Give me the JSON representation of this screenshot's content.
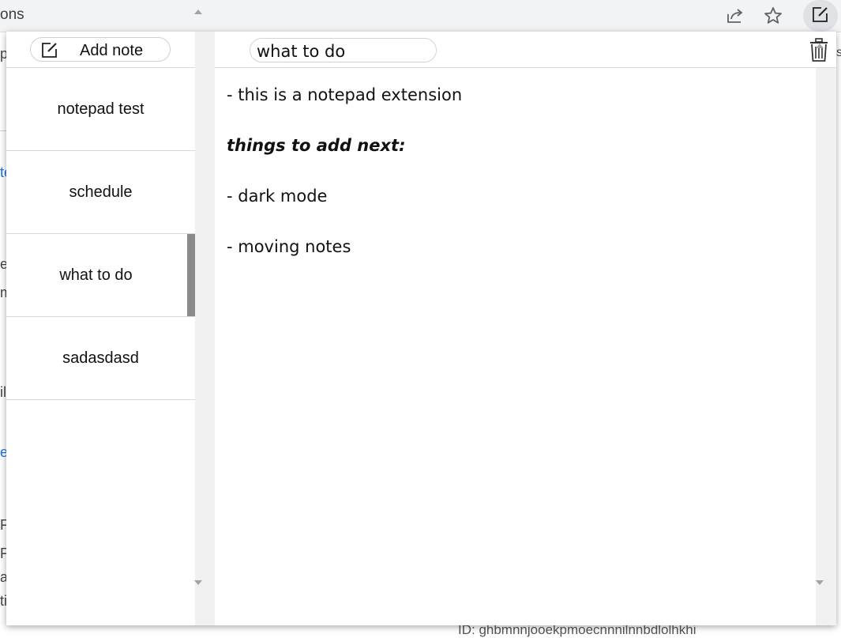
{
  "browser": {
    "tab_title_fragment": "ons",
    "toolbar_icons": [
      "share-icon",
      "star-icon",
      "extension-notepad-icon"
    ]
  },
  "background_page": {
    "fragments": [
      "p",
      "te",
      "ep",
      "m",
      "il",
      "e",
      "F",
      "F",
      "ar",
      "ti",
      "s"
    ],
    "id_text": "ID: ghbmnnjooekpmoecnnnilnnbdlolhkhi"
  },
  "sidebar": {
    "add_note_label": "Add note",
    "notes": [
      {
        "label": "notepad test"
      },
      {
        "label": "schedule"
      },
      {
        "label": "what to do"
      },
      {
        "label": "sadasdasd"
      }
    ],
    "selected_index": 2
  },
  "editor": {
    "title": "what to do",
    "content": [
      {
        "text": "- this is a notepad extension",
        "style": "normal"
      },
      {
        "text": "things to add next:",
        "style": "bold-italic"
      },
      {
        "text": "- dark mode",
        "style": "normal"
      },
      {
        "text": "- moving notes",
        "style": "normal"
      }
    ]
  },
  "colors": {
    "chrome_bg": "#f1f3f4",
    "scroll_thumb": "#8a8a8a",
    "link_blue": "#1a73e8"
  }
}
